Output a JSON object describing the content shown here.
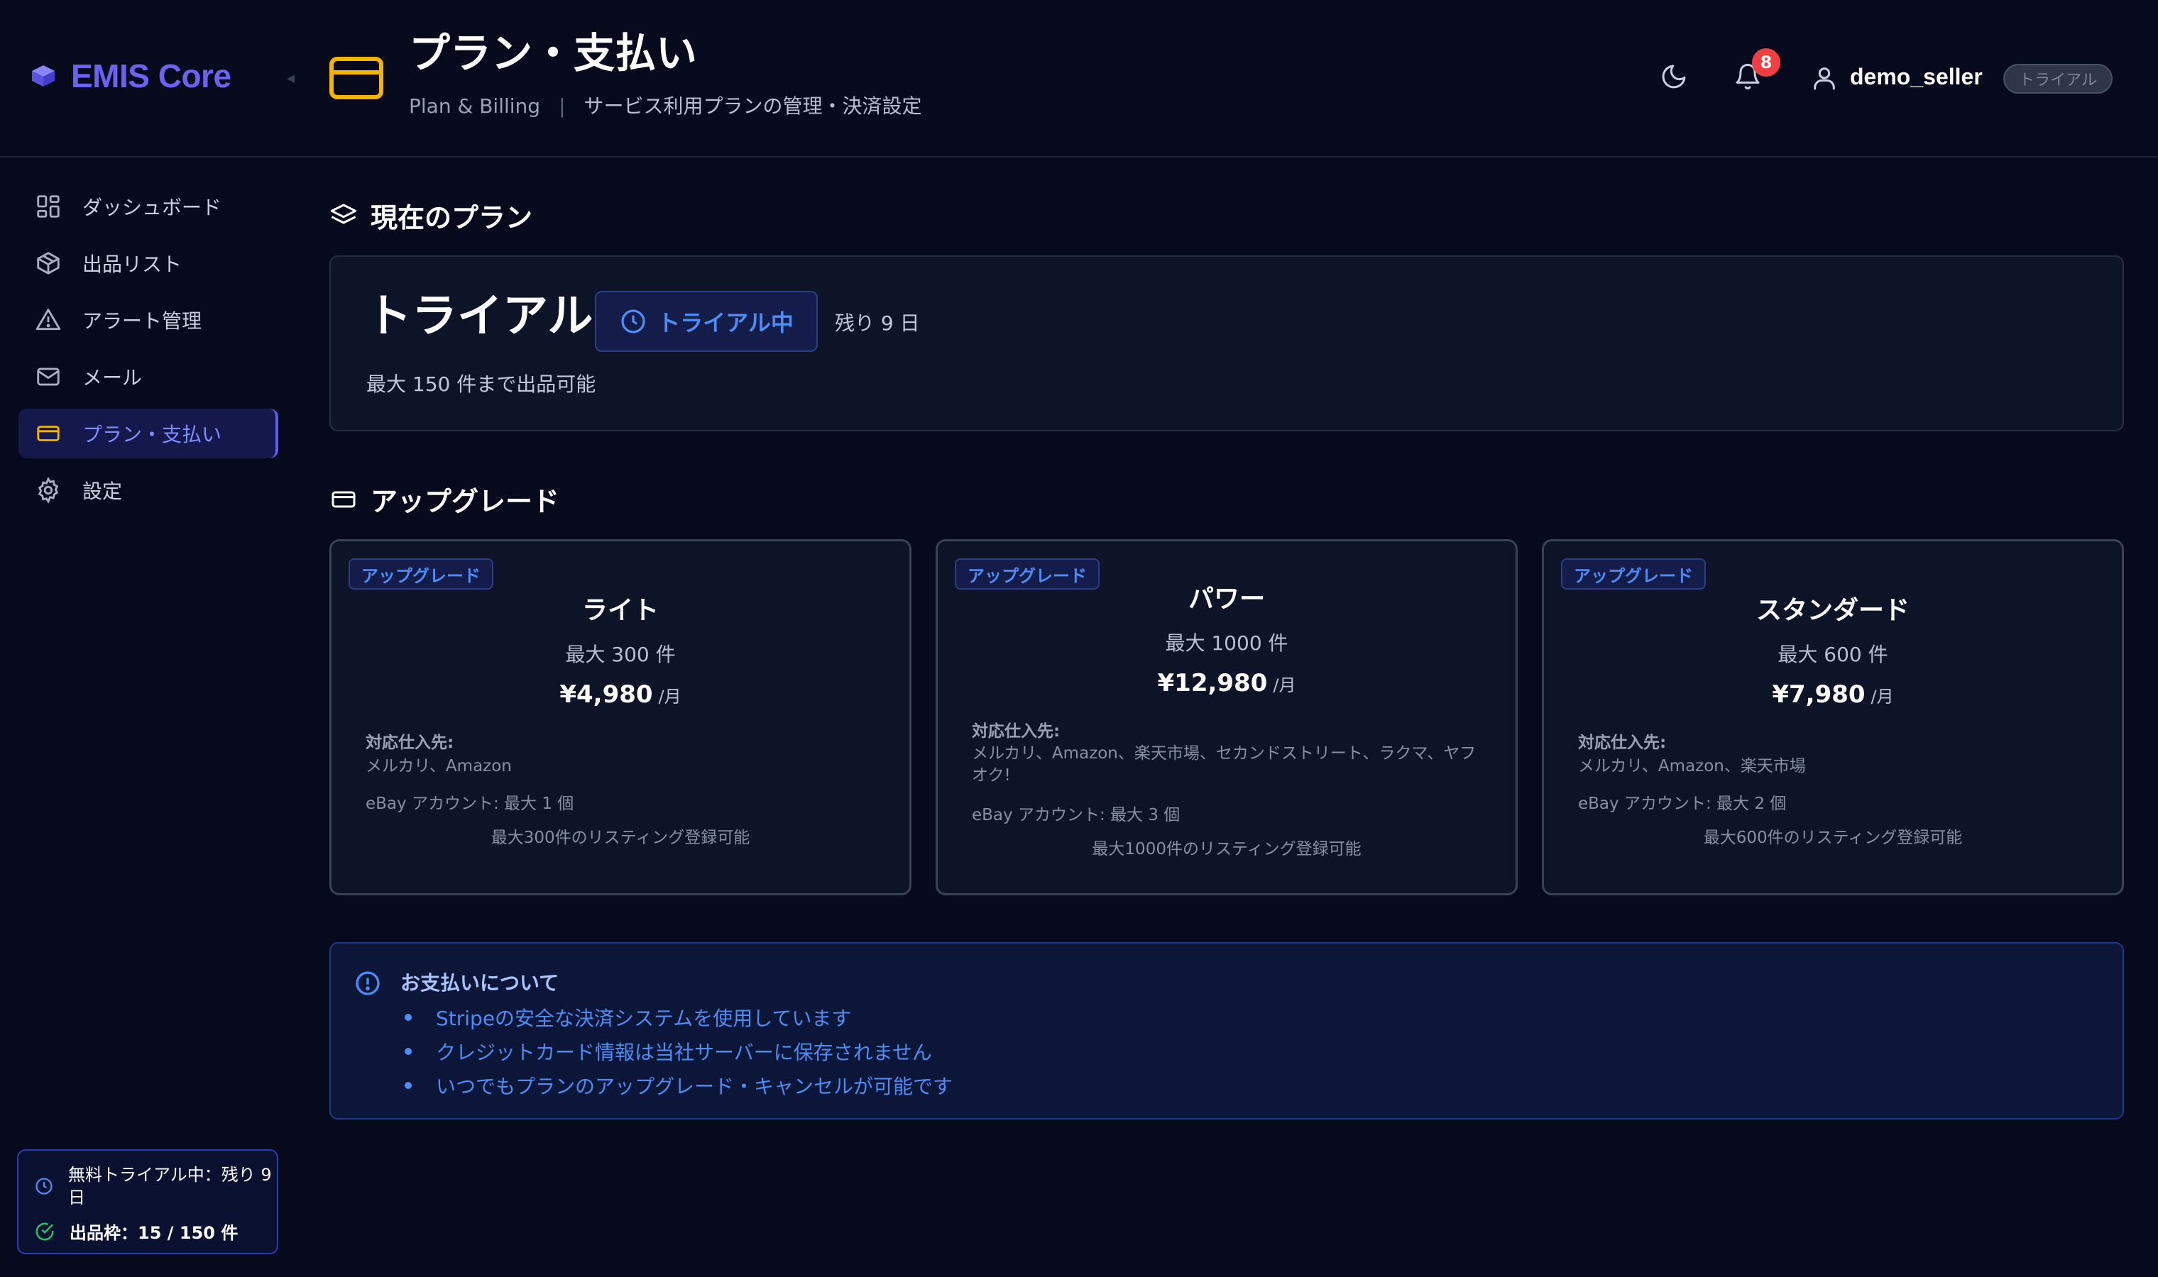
{
  "brand": {
    "name": "EMIS Core"
  },
  "header": {
    "title": "プラン・支払い",
    "subtitle_en": "Plan & Billing",
    "subtitle_sep": "|",
    "subtitle_jp": "サービス利用プランの管理・決済設定",
    "notification_count": "8",
    "username": "demo_seller",
    "user_badge": "トライアル"
  },
  "sidebar": {
    "items": [
      {
        "label": "ダッシュボード",
        "icon": "dashboard-grid-icon"
      },
      {
        "label": "出品リスト",
        "icon": "package-box-icon"
      },
      {
        "label": "アラート管理",
        "icon": "alert-triangle-icon"
      },
      {
        "label": "メール",
        "icon": "mail-envelope-icon"
      },
      {
        "label": "プラン・支払い",
        "icon": "credit-card-icon",
        "active": true
      },
      {
        "label": "設定",
        "icon": "settings-gear-icon"
      }
    ],
    "trial_status": "無料トライアル中：残り 9日",
    "listing_quota": "出品枠：15 / 150 件"
  },
  "current_plan": {
    "section_title": "現在のプラン",
    "name": "トライアル",
    "status": "トライアル中",
    "remaining": "残り 9 日",
    "limit": "最大 150 件まで出品可能"
  },
  "upgrade": {
    "section_title": "アップグレード",
    "plans": [
      {
        "badge": "アップグレード",
        "name": "ライト",
        "max": "最大 300 件",
        "price": "¥4,980",
        "per": "/月",
        "sources_label": "対応仕入先:",
        "sources": "メルカリ、Amazon",
        "ebay": "eBay アカウント: 最大 1 個",
        "listing": "最大300件のリスティング登録可能"
      },
      {
        "badge": "アップグレード",
        "name": "パワー",
        "max": "最大 1000 件",
        "price": "¥12,980",
        "per": "/月",
        "sources_label": "対応仕入先:",
        "sources": "メルカリ、Amazon、楽天市場、セカンドストリート、ラクマ、ヤフオク!",
        "ebay": "eBay アカウント: 最大 3 個",
        "listing": "最大1000件のリスティング登録可能"
      },
      {
        "badge": "アップグレード",
        "name": "スタンダード",
        "max": "最大 600 件",
        "price": "¥7,980",
        "per": "/月",
        "sources_label": "対応仕入先:",
        "sources": "メルカリ、Amazon、楽天市場",
        "ebay": "eBay アカウント: 最大 2 個",
        "listing": "最大600件のリスティング登録可能"
      }
    ]
  },
  "payment_info": {
    "title": "お支払いについて",
    "items": [
      "Stripeの安全な決済システムを使用しています",
      "クレジットカード情報は当社サーバーに保存されません",
      "いつでもプランのアップグレード・キャンセルが可能です"
    ]
  },
  "colors": {
    "accent": "#6b63f0",
    "link_blue": "#4e8cf5",
    "card_icon": "#f4b400",
    "badge_red": "#ef3f43",
    "success_green": "#22c55e"
  }
}
